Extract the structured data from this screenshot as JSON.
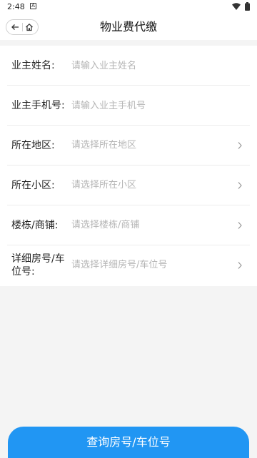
{
  "status_bar": {
    "time": "2:48",
    "notification_icon": "A"
  },
  "nav": {
    "title": "物业费代缴",
    "back_icon": "arrow-left",
    "home_icon": "home"
  },
  "form": {
    "rows": [
      {
        "label": "业主姓名:",
        "placeholder": "请输入业主姓名",
        "type": "input"
      },
      {
        "label": "业主手机号:",
        "placeholder": "请输入业主手机号",
        "type": "input"
      },
      {
        "label": "所在地区:",
        "placeholder": "请选择所在地区",
        "type": "select"
      },
      {
        "label": "所在小区:",
        "placeholder": "请选择所在小区",
        "type": "select"
      },
      {
        "label": "楼栋/商铺:",
        "placeholder": "请选择楼栋/商铺",
        "type": "select"
      },
      {
        "label": "详细房号/车位号:",
        "placeholder": "请选择详细房号/车位号",
        "type": "select"
      }
    ]
  },
  "submit": {
    "label": "查询房号/车位号"
  },
  "colors": {
    "primary": "#2196f3",
    "background": "#f4f4f4",
    "placeholder": "#b5b5b5"
  }
}
